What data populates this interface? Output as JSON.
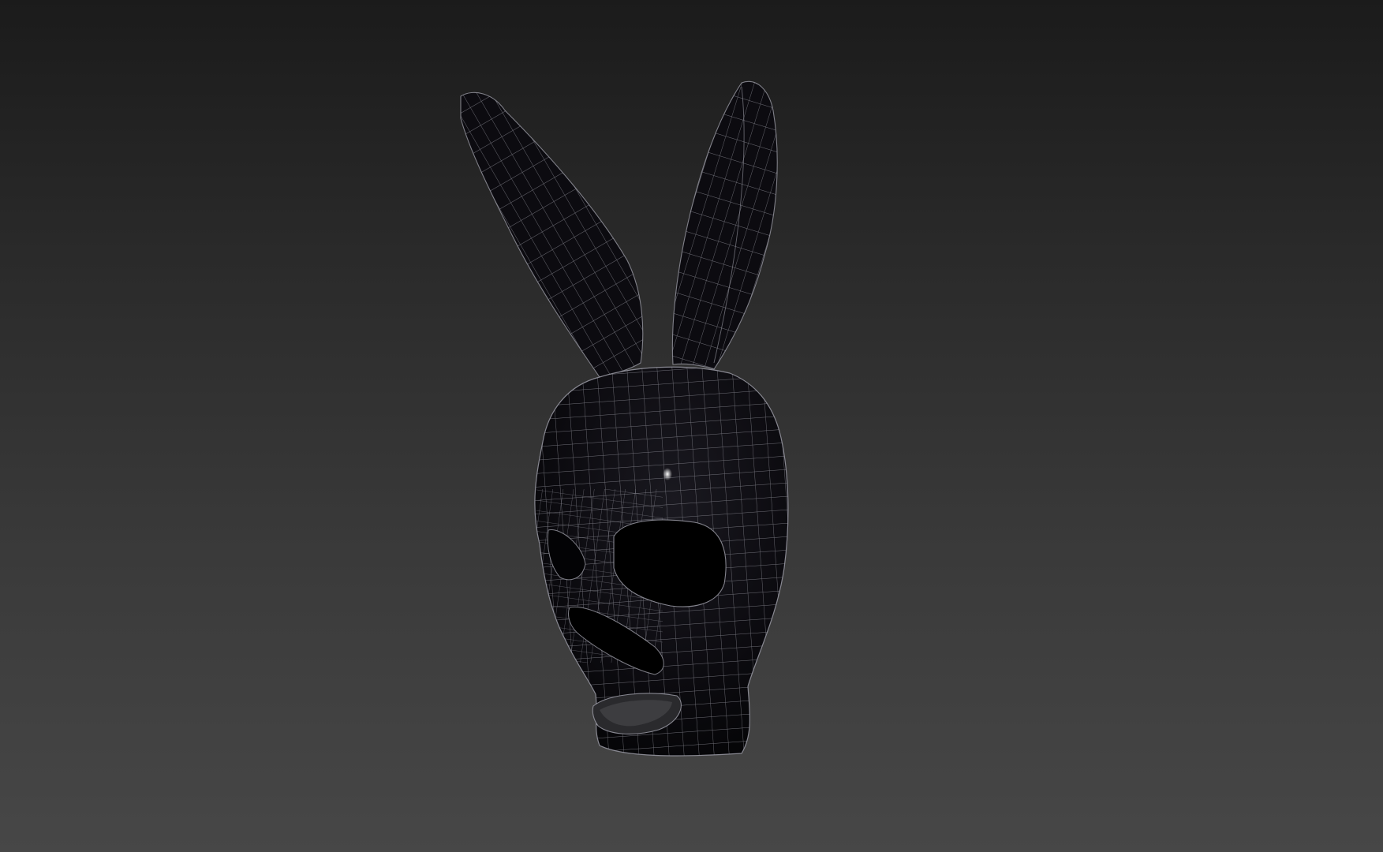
{
  "viewport": {
    "background_top": "#1b1b1b",
    "background_bottom": "#474747"
  },
  "model": {
    "subject": "bunny-ear-mask",
    "shading": "wireframe-on-shaded",
    "fill_color": "#0b0a0e",
    "wire_color": "#8e8e98",
    "specular_color": "#ffffff"
  }
}
